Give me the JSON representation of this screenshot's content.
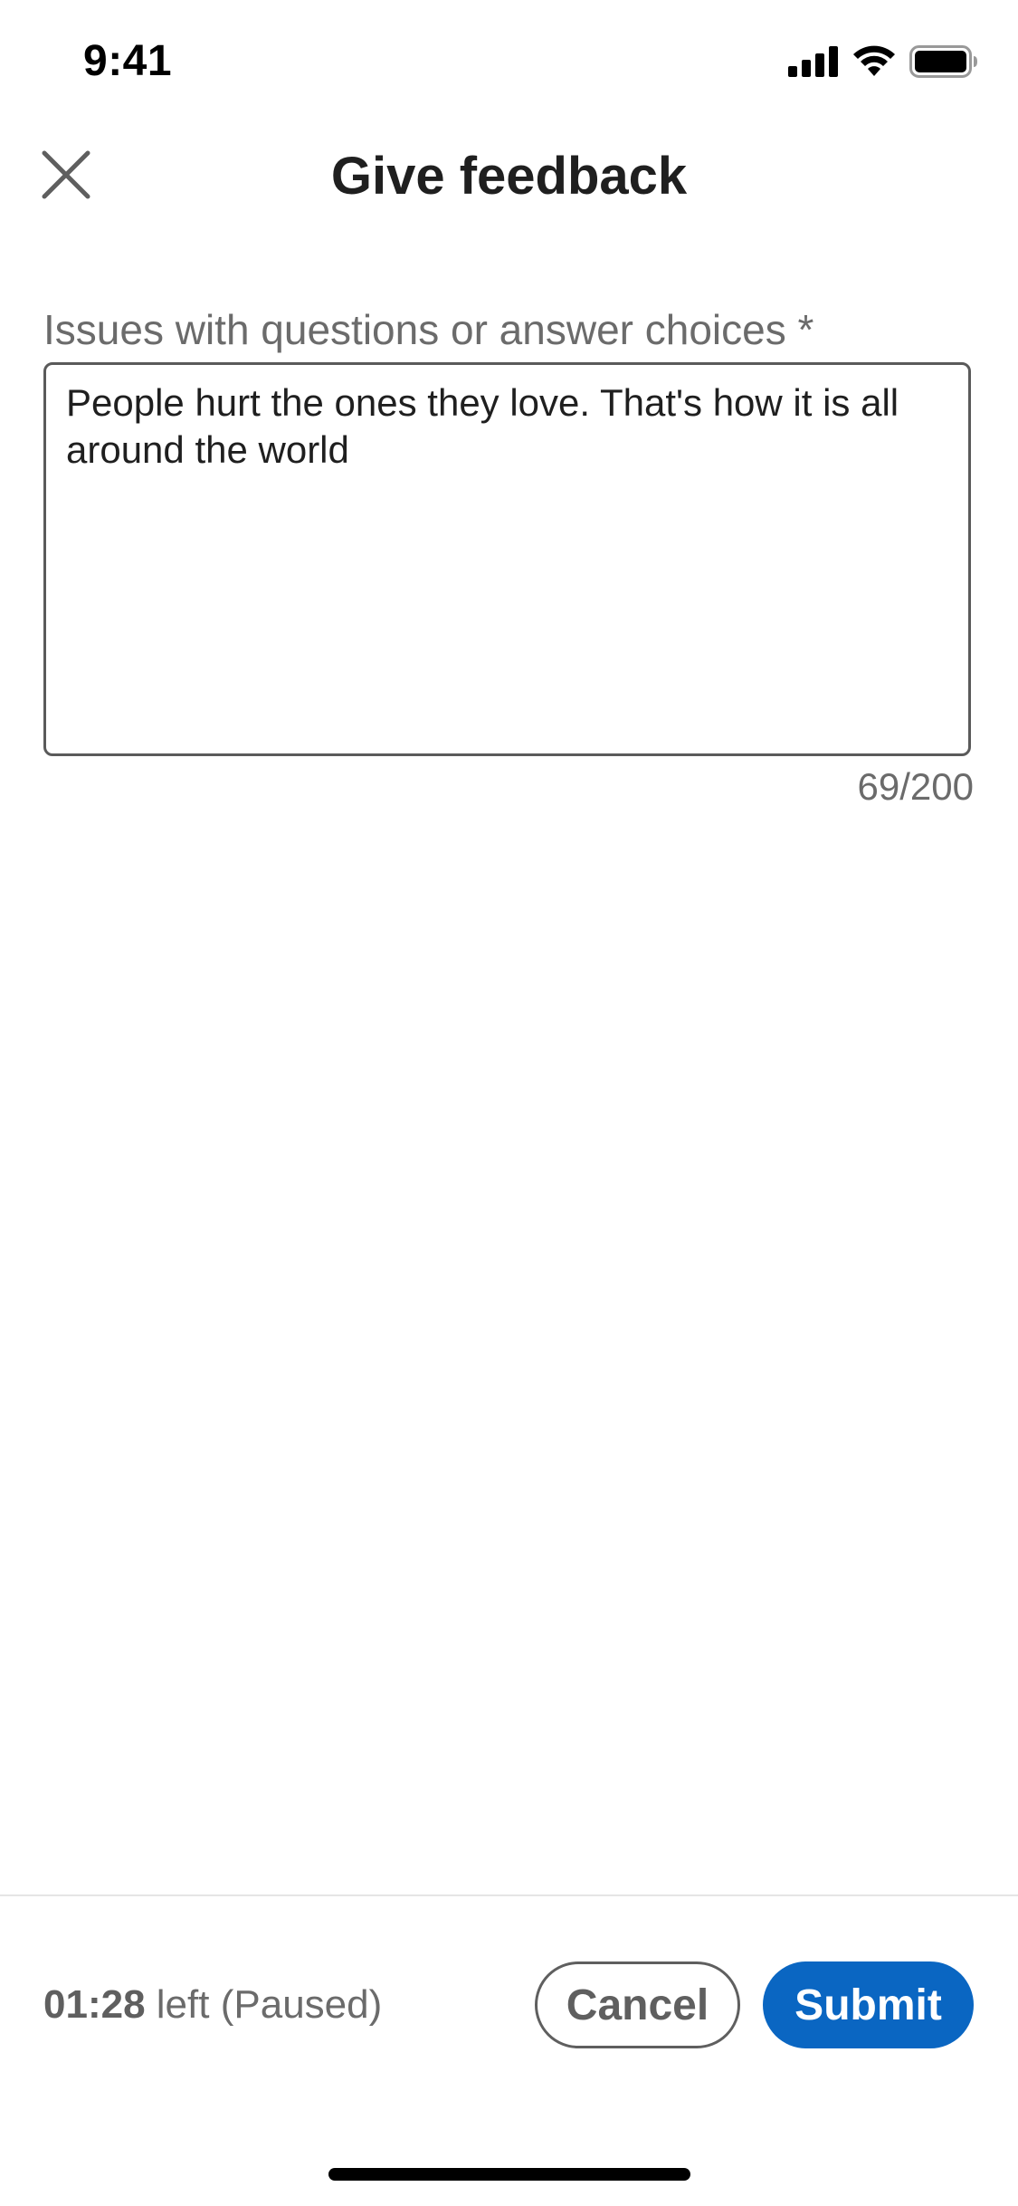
{
  "status_bar": {
    "time": "9:41",
    "icons": [
      "cellular-signal-icon",
      "wifi-icon",
      "battery-icon"
    ]
  },
  "header": {
    "close_icon": "close-icon",
    "title": "Give feedback"
  },
  "form": {
    "label": "Issues with questions or answer choices *",
    "value": "People hurt the ones they love. That's how it is all around the world",
    "char_count": "69/200"
  },
  "footer": {
    "timer_value": "01:28",
    "timer_suffix_left": "left",
    "timer_status": "(Paused)",
    "cancel_label": "Cancel",
    "submit_label": "Submit"
  },
  "colors": {
    "accent": "#0a66c2",
    "text_primary": "#1f1f1f",
    "text_secondary": "#6b6b6b"
  }
}
